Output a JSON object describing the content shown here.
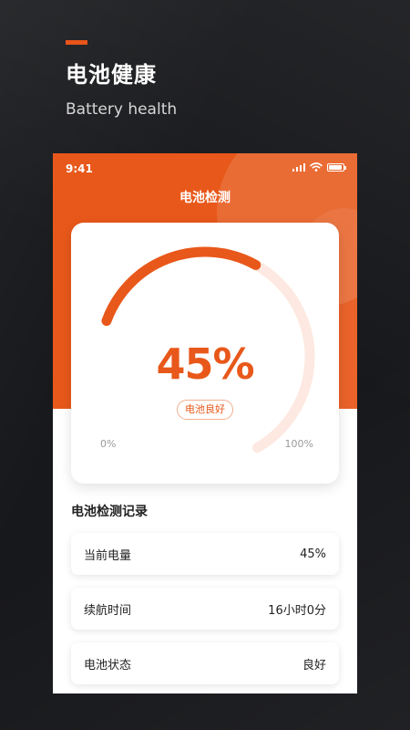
{
  "hero": {
    "title": "电池健康",
    "subtitle": "Battery health"
  },
  "status_bar": {
    "time": "9:41"
  },
  "header": {
    "title": "电池检测"
  },
  "gauge": {
    "percent_label": "45%",
    "level": 0.45,
    "status": "电池良好",
    "min_label": "0%",
    "max_label": "100%"
  },
  "records": {
    "title": "电池检测记录",
    "items": [
      {
        "label": "当前电量",
        "value": "45%"
      },
      {
        "label": "续航时间",
        "value": "16小时0分"
      },
      {
        "label": "电池状态",
        "value": "良好"
      }
    ]
  },
  "colors": {
    "accent": "#e8581a",
    "track": "#fde9e1",
    "background": "#17181b"
  },
  "icons": [
    "signal-icon",
    "wifi-icon",
    "battery-icon"
  ]
}
